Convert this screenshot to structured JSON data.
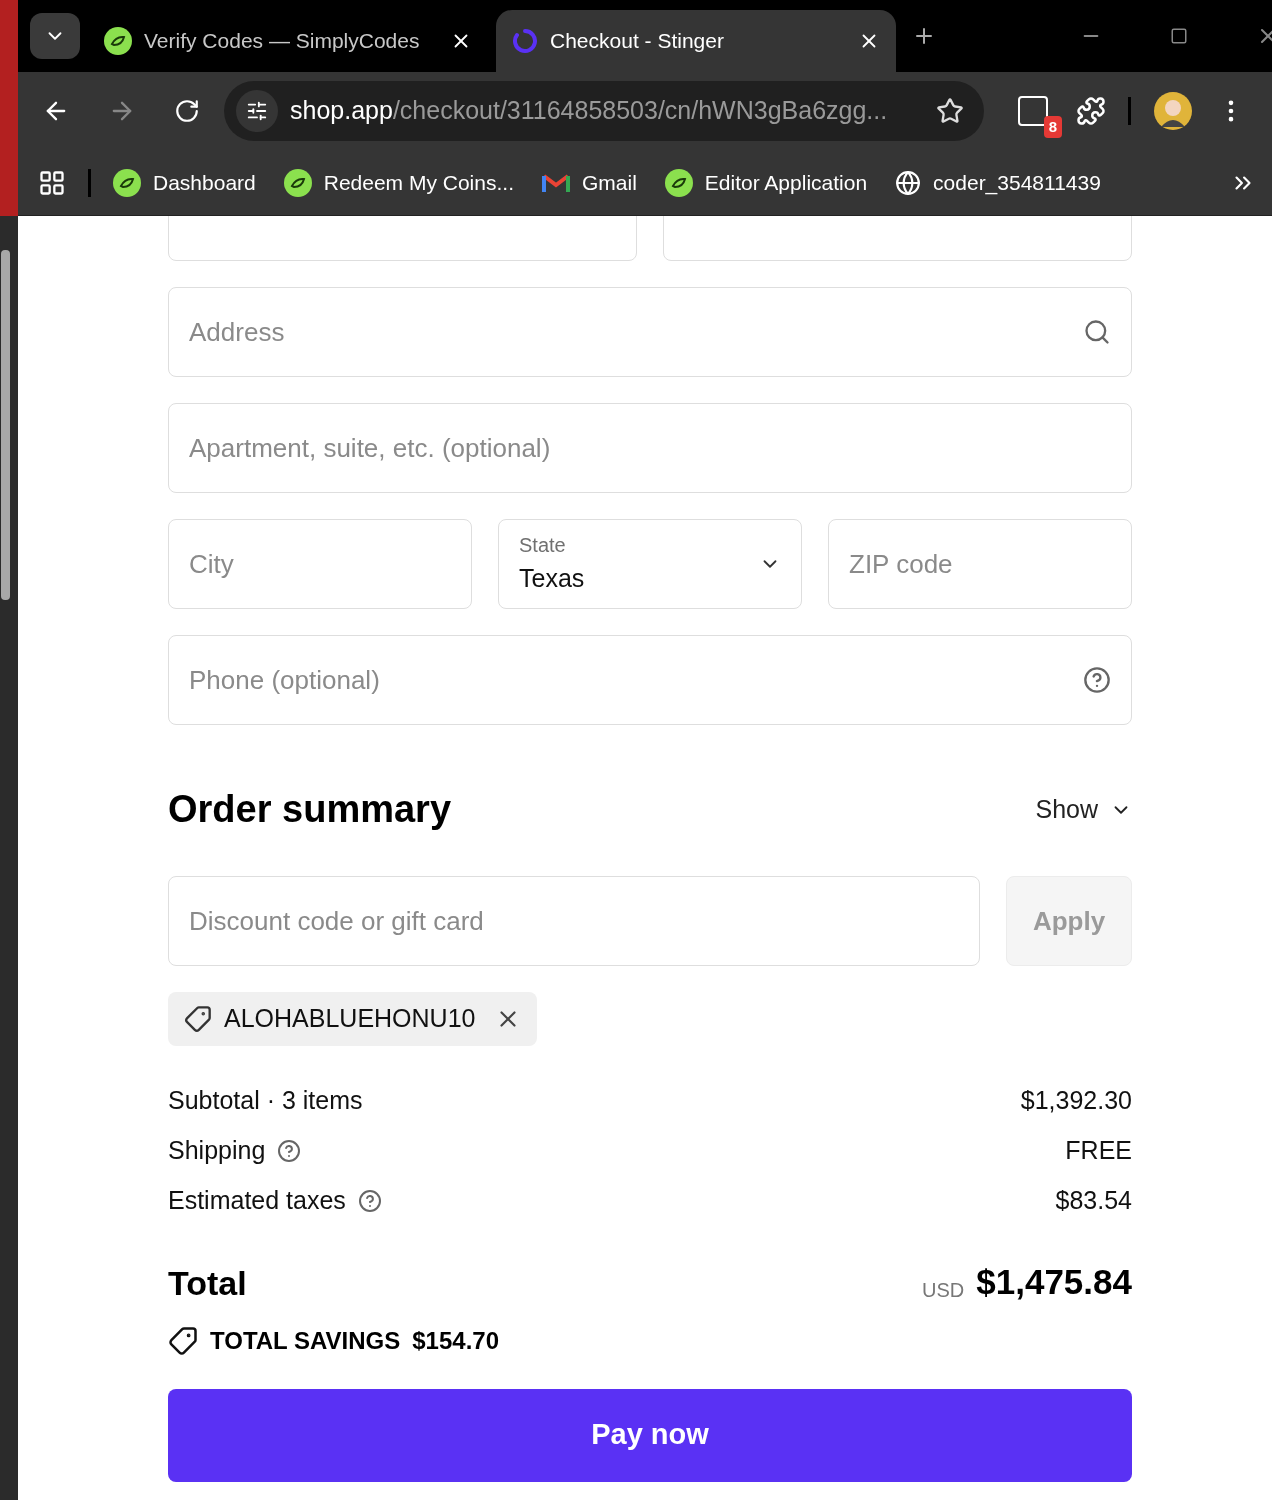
{
  "tabs": [
    {
      "title": "Verify Codes — SimplyCodes",
      "kind": "leaf",
      "selected": false
    },
    {
      "title": "Checkout - Stinger",
      "kind": "ring",
      "selected": true
    }
  ],
  "address_bar": {
    "host": "shop.app",
    "path": "/checkout/31164858503/cn/hWN3gBa6zgg..."
  },
  "extension_badge": "8",
  "bookmarks": [
    {
      "label": "Dashboard",
      "kind": "leaf"
    },
    {
      "label": "Redeem My Coins...",
      "kind": "leaf"
    },
    {
      "label": "Gmail",
      "kind": "mail"
    },
    {
      "label": "Editor Application",
      "kind": "leaf"
    },
    {
      "label": "coder_354811439",
      "kind": "globe"
    }
  ],
  "form_rows": [
    [
      {
        "kind": "clipped"
      },
      {
        "kind": "clipped"
      }
    ],
    [
      {
        "kind": "search",
        "placeholder": "Address"
      }
    ],
    [
      {
        "kind": "text",
        "placeholder": "Apartment, suite, etc. (optional)"
      }
    ],
    [
      {
        "kind": "text",
        "placeholder": "City"
      },
      {
        "kind": "select",
        "label": "State",
        "value": "Texas"
      },
      {
        "kind": "text",
        "placeholder": "ZIP code"
      }
    ],
    [
      {
        "kind": "help",
        "placeholder": "Phone (optional)"
      }
    ]
  ],
  "order_summary": {
    "title": "Order summary",
    "toggle": "Show",
    "discount": {
      "placeholder": "Discount code or gift card",
      "button": "Apply",
      "button_disabled": true
    },
    "applied_code": "ALOHABLUEHONU10",
    "lines": [
      {
        "label": "Subtotal · 3 items",
        "value": "$1,392.30",
        "help": false
      },
      {
        "label": "Shipping",
        "value": "FREE",
        "help": true
      },
      {
        "label": "Estimated taxes",
        "value": "$83.54",
        "help": true
      }
    ],
    "total": {
      "label": "Total",
      "currency": "USD",
      "amount": "$1,475.84"
    },
    "savings": {
      "label": "TOTAL SAVINGS",
      "amount": "$154.70"
    },
    "pay_button": "Pay now"
  }
}
